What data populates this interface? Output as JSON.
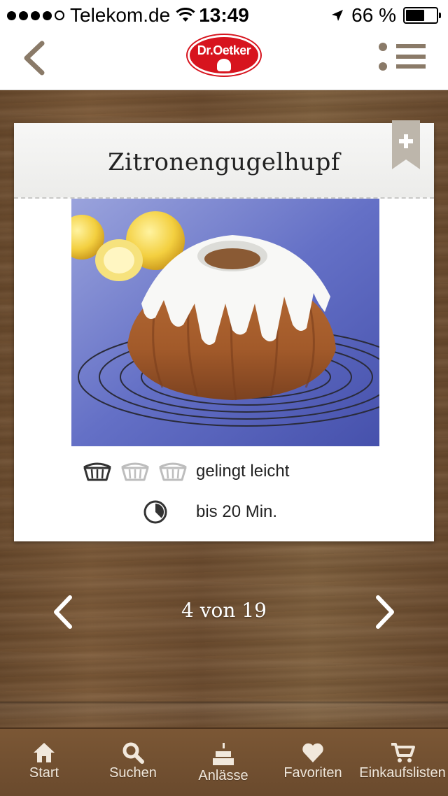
{
  "status_bar": {
    "carrier": "Telekom.de",
    "time": "13:49",
    "battery": "66 %",
    "battery_level": 0.66
  },
  "header": {
    "logo_text": "Dr.Oetker"
  },
  "recipe": {
    "title": "Zitronengugelhupf",
    "difficulty": {
      "label": "gelingt leicht",
      "level": 1,
      "max": 3
    },
    "time_label": "bis 20 Min."
  },
  "pager": {
    "text": "4 von 19"
  },
  "tabs": [
    {
      "label": "Start",
      "icon": "home-icon"
    },
    {
      "label": "Suchen",
      "icon": "search-icon"
    },
    {
      "label": "Anlässe",
      "icon": "cake-icon"
    },
    {
      "label": "Favoriten",
      "icon": "heart-icon"
    },
    {
      "label": "Einkaufslisten",
      "icon": "cart-icon"
    }
  ],
  "colors": {
    "accent_brown": "#8a7a68",
    "brand_red": "#d7141e",
    "wood": "#6b4a2e"
  }
}
